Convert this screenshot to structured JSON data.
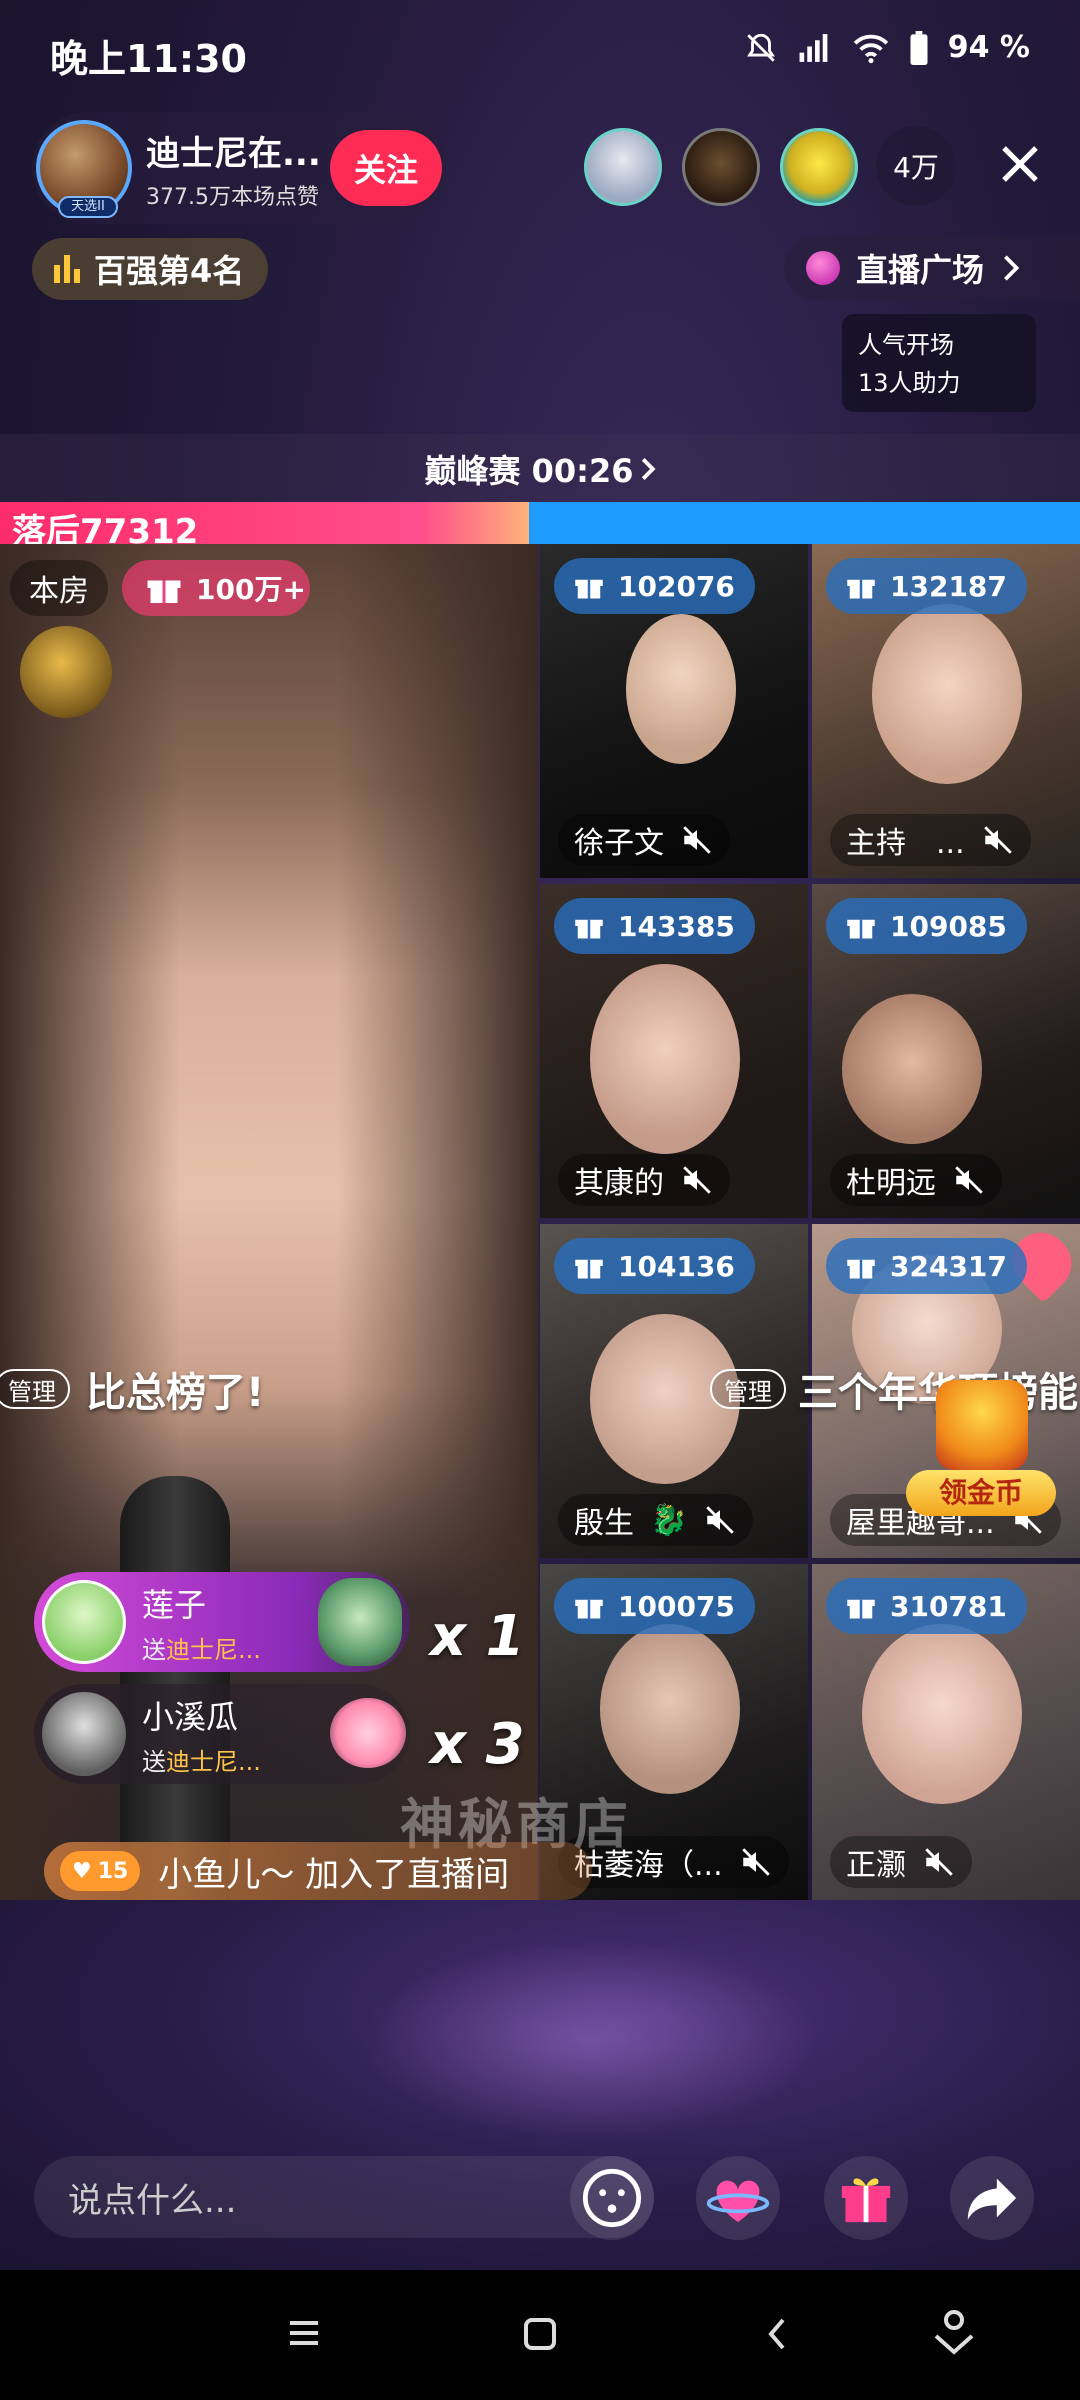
{
  "status_bar": {
    "time": "晚上11:30",
    "battery": "94 %"
  },
  "host": {
    "name": "迪士尼在...",
    "likes": "377.5万本场点赞",
    "badge": "天选II",
    "follow_label": "关注"
  },
  "viewers": {
    "count": "4万"
  },
  "rank": {
    "label": "百强第4名"
  },
  "plaza": {
    "label": "直播广场",
    "info_line1": "人气开场",
    "info_line2": "13人助力"
  },
  "pk": {
    "timer": "巅峰赛 00:26",
    "behind_label": "落后77312",
    "progress": 0.49
  },
  "main_room": {
    "room_tag": "本房",
    "gift_total": "100万+",
    "admin_tag": "管理",
    "comment": "比总榜了!"
  },
  "tiles": [
    {
      "score": "102076",
      "name": "徐子文"
    },
    {
      "score": "132187",
      "name": "主持　..."
    },
    {
      "score": "143385",
      "name": "其康的"
    },
    {
      "score": "109085",
      "name": "杜明远"
    },
    {
      "score": "104136",
      "name": "殷生"
    },
    {
      "score": "324317",
      "name": "屋里趣哥..."
    },
    {
      "score": "100075",
      "name": "枯萎海（..."
    },
    {
      "score": "310781",
      "name": "正灏"
    }
  ],
  "tile6_overlay": {
    "admin_tag": "管理",
    "comment": "三个年华顶榜能"
  },
  "gifts": [
    {
      "user": "莲子",
      "prefix": "送",
      "target": "迪士尼...",
      "combo": "x 1"
    },
    {
      "user": "小溪瓜",
      "prefix": "送",
      "target": "迪士尼...",
      "combo": "x 3"
    }
  ],
  "coin_button": {
    "label": "领金币"
  },
  "mystery_shop": "神秘商店",
  "join": {
    "level": "15",
    "text": "小鱼儿～ 加入了直播间"
  },
  "input": {
    "placeholder": "说点什么..."
  },
  "colors": {
    "accent_red": "#fe2c55",
    "pk_blue": "#1e9bff",
    "pk_pink": "#fe2c6a"
  }
}
